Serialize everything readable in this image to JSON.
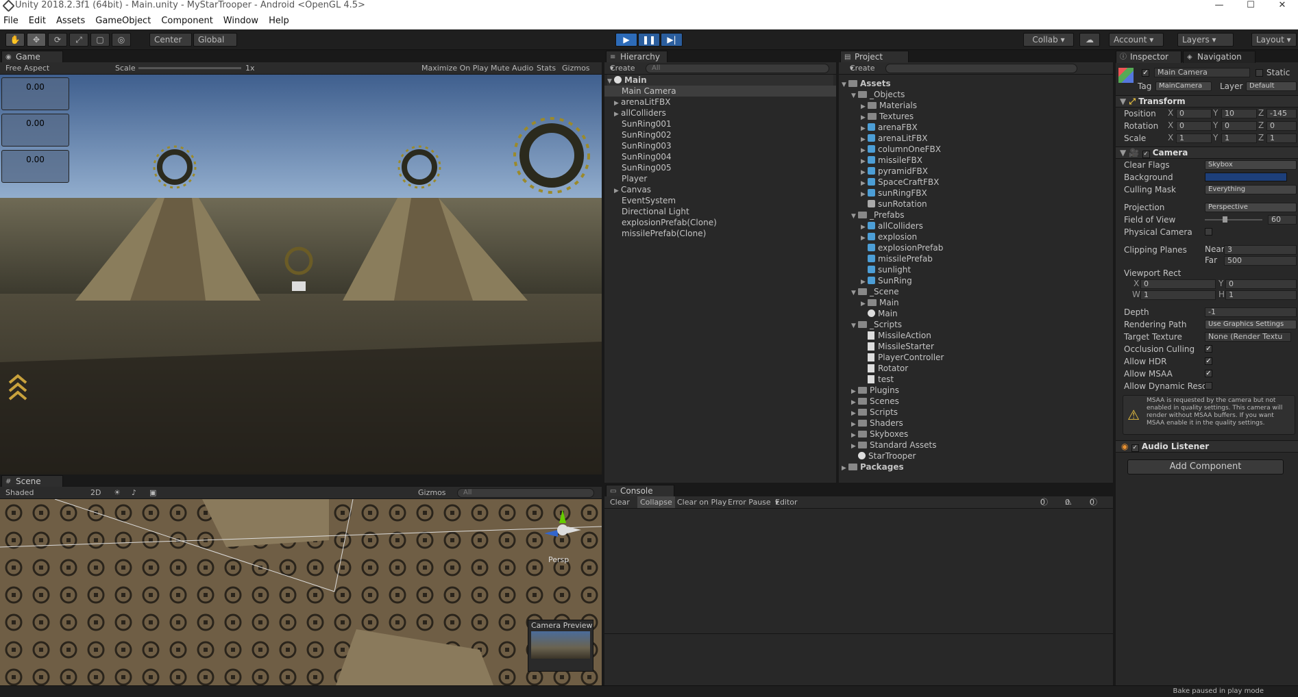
{
  "window": {
    "title": "Unity 2018.2.3f1 (64bit) - Main.unity - MyStarTrooper - Android <OpenGL 4.5>",
    "min": "—",
    "max": "☐",
    "close": "✕"
  },
  "menu": [
    "File",
    "Edit",
    "Assets",
    "GameObject",
    "Component",
    "Window",
    "Help"
  ],
  "toolbar": {
    "pivot": "Center",
    "space": "Global",
    "collab": "Collab",
    "account": "Account",
    "layers": "Layers",
    "layout": "Layout"
  },
  "game": {
    "tab": "Game",
    "aspect": "Free Aspect",
    "scale_label": "Scale",
    "scale_value": "1x",
    "max_on_play": "Maximize On Play",
    "mute": "Mute Audio",
    "stats": "Stats",
    "gizmos": "Gizmos",
    "values": [
      "0.00",
      "0.00",
      "0.00"
    ]
  },
  "scene": {
    "tab": "Scene",
    "shading": "Shaded",
    "mode2d": "2D",
    "gizmos": "Gizmos",
    "search": "All",
    "persp": "Persp",
    "preview": "Camera Preview"
  },
  "hierarchy": {
    "tab": "Hierarchy",
    "create": "Create",
    "search": "All",
    "root": "Main",
    "items": [
      "Main Camera",
      "arenaLitFBX",
      "allColliders",
      "SunRing001",
      "SunRing002",
      "SunRing003",
      "SunRing004",
      "SunRing005",
      "Player",
      "Canvas",
      "EventSystem",
      "Directional Light",
      "explosionPrefab(Clone)",
      "missilePrefab(Clone)"
    ]
  },
  "project": {
    "tab": "Project",
    "create": "Create",
    "items": [
      "Assets",
      "_Objects",
      "Materials",
      "Textures",
      "arenaFBX",
      "arenaLitFBX",
      "columnOneFBX",
      "missileFBX",
      "pyramidFBX",
      "SpaceCraftFBX",
      "sunRingFBX",
      "sunRotation",
      "_Prefabs",
      "allColliders",
      "explosion",
      "explosionPrefab",
      "missilePrefab",
      "sunlight",
      "SunRing",
      "_Scene",
      "Main",
      "Main",
      "_Scripts",
      "MissileAction",
      "MissileStarter",
      "PlayerController",
      "Rotator",
      "test",
      "Plugins",
      "Scenes",
      "Scripts",
      "Shaders",
      "Skyboxes",
      "Standard Assets",
      "StarTrooper",
      "Packages"
    ]
  },
  "console": {
    "tab": "Console",
    "clear": "Clear",
    "collapse": "Collapse",
    "clear_on_play": "Clear on Play",
    "error_pause": "Error Pause",
    "editor": "Editor",
    "counts": [
      "0",
      "0",
      "0"
    ]
  },
  "inspector": {
    "tab": "Inspector",
    "nav_tab": "Navigation",
    "object_name": "Main Camera",
    "static": "Static",
    "tag_label": "Tag",
    "tag": "MainCamera",
    "layer_label": "Layer",
    "layer": "Default",
    "transform": {
      "title": "Transform",
      "position": "Position",
      "rotation": "Rotation",
      "scale": "Scale",
      "pos": [
        "0",
        "10",
        "-145"
      ],
      "rot": [
        "0",
        "0",
        "0"
      ],
      "scl": [
        "1",
        "1",
        "1"
      ]
    },
    "camera": {
      "title": "Camera",
      "clear_flags": "Clear Flags",
      "clear_flags_val": "Skybox",
      "background": "Background",
      "culling_mask": "Culling Mask",
      "culling_mask_val": "Everything",
      "projection": "Projection",
      "projection_val": "Perspective",
      "fov": "Field of View",
      "fov_val": "60",
      "physical": "Physical Camera",
      "clipping": "Clipping Planes",
      "near": "Near",
      "near_val": "3",
      "far": "Far",
      "far_val": "500",
      "viewport": "Viewport Rect",
      "vx": "0",
      "vy": "0",
      "vw": "1",
      "vh": "1",
      "depth": "Depth",
      "depth_val": "-1",
      "rendering_path": "Rendering Path",
      "rendering_path_val": "Use Graphics Settings",
      "target_texture": "Target Texture",
      "target_texture_val": "None (Render Textu",
      "occlusion": "Occlusion Culling",
      "hdr": "Allow HDR",
      "msaa": "Allow MSAA",
      "dynres": "Allow Dynamic Reso",
      "warning": "MSAA is requested by the camera but not enabled in quality settings. This camera will render without MSAA buffers. If you want MSAA enable it in the quality settings."
    },
    "audio": {
      "title": "Audio Listener"
    },
    "add_component": "Add Component"
  },
  "status": "Bake paused in play mode",
  "colors": {
    "accent": "#2d6bb8",
    "bg": "#191919",
    "panel": "#282828",
    "bg_swatch": "#1d3f7a"
  }
}
